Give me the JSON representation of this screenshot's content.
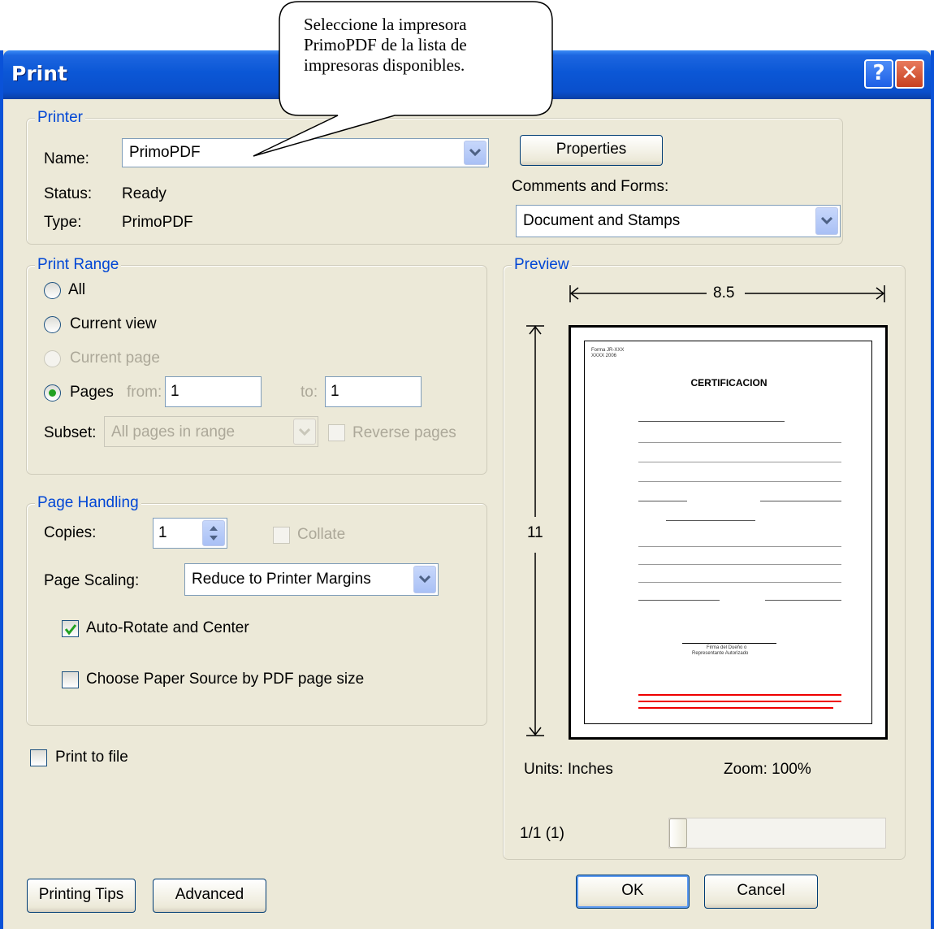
{
  "window": {
    "title": "Print"
  },
  "callout": {
    "lines": [
      "Seleccione la impresora",
      "PrimoPDF de la lista de",
      "impresoras disponibles."
    ]
  },
  "printer": {
    "group_label": "Printer",
    "name_label": "Name:",
    "name_value": "PrimoPDF",
    "status_label": "Status:",
    "status_value": "Ready",
    "type_label": "Type:",
    "type_value": "PrimoPDF",
    "properties_button": "Properties",
    "comments_label": "Comments and Forms:",
    "comments_value": "Document and Stamps"
  },
  "print_range": {
    "group_label": "Print Range",
    "all": "All",
    "current_view": "Current view",
    "current_page": "Current page",
    "pages": "Pages",
    "from_label": "from:",
    "from_value": "1",
    "to_label": "to:",
    "to_value": "1",
    "subset_label": "Subset:",
    "subset_value": "All pages in range",
    "reverse_pages": "Reverse pages",
    "selected": "pages"
  },
  "page_handling": {
    "group_label": "Page Handling",
    "copies_label": "Copies:",
    "copies_value": "1",
    "collate": "Collate",
    "scaling_label": "Page Scaling:",
    "scaling_value": "Reduce to Printer Margins",
    "auto_rotate": "Auto-Rotate and Center",
    "auto_rotate_checked": true,
    "paper_source": "Choose Paper Source by PDF page size",
    "paper_source_checked": false
  },
  "print_to_file": {
    "label": "Print to file",
    "checked": false
  },
  "preview": {
    "group_label": "Preview",
    "width": "8.5",
    "height": "11",
    "units": "Units: Inches",
    "zoom": "Zoom: 100%",
    "page_counter": "1/1 (1)",
    "doc_title": "CERTIFICACION",
    "doc_header": [
      "Forma JR-XXX",
      "XXXX 2006"
    ],
    "doc_signature": [
      "Firma del Dueño o",
      "Representante Autorizado"
    ]
  },
  "buttons": {
    "printing_tips": "Printing Tips",
    "advanced": "Advanced",
    "ok": "OK",
    "cancel": "Cancel"
  },
  "colors": {
    "titlebar": "#0a4fcc",
    "group_label": "#0046d5",
    "dialog_bg": "#ece9d8"
  }
}
